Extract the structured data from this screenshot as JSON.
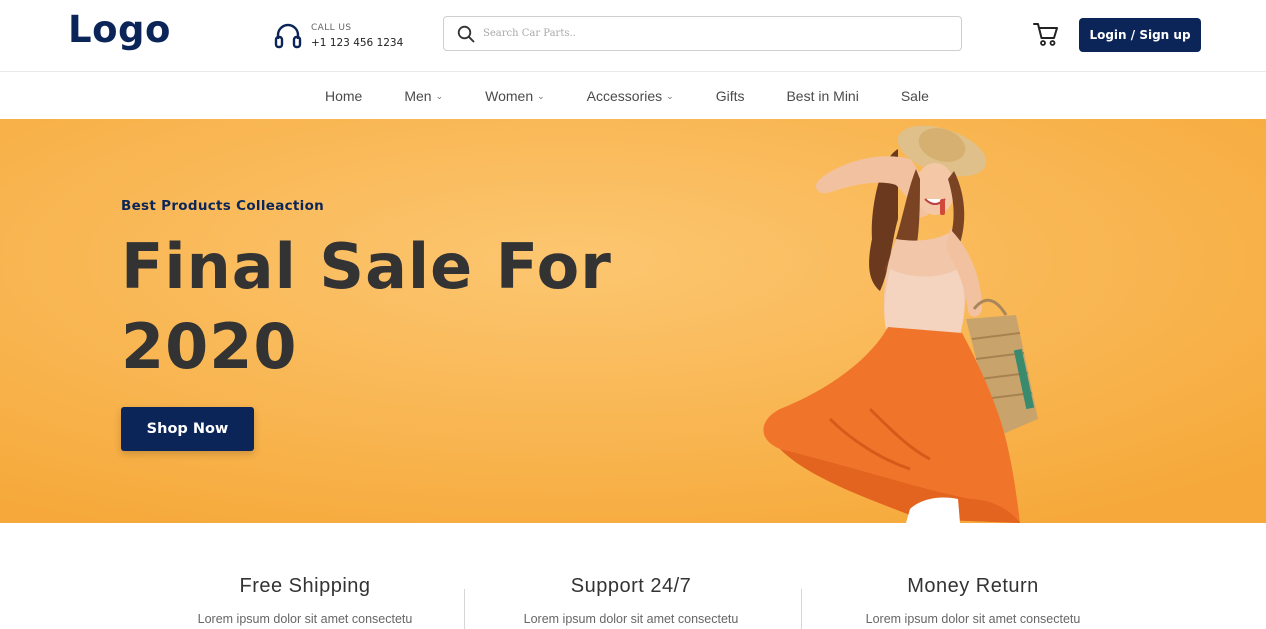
{
  "colors": {
    "brand": "#0b2559",
    "hero_bg": "#f8b349",
    "hero_bg_light": "#fcc670",
    "dress": "#f0752b"
  },
  "header": {
    "logo": "Logo",
    "call_label": "CALL US",
    "phone": "+1 123 456 1234",
    "headset_icon": "headset-icon",
    "search_placeholder": "Search Car Parts..",
    "search_icon": "search-icon",
    "cart_icon": "cart-icon",
    "login_label": "Login / Sign up"
  },
  "nav": {
    "items": [
      {
        "label": "Home",
        "dropdown": false
      },
      {
        "label": "Men",
        "dropdown": true
      },
      {
        "label": "Women",
        "dropdown": true
      },
      {
        "label": "Accessories",
        "dropdown": true
      },
      {
        "label": "Gifts",
        "dropdown": false
      },
      {
        "label": "Best in Mini",
        "dropdown": false
      },
      {
        "label": "Sale",
        "dropdown": false
      }
    ],
    "chevron": "⌄"
  },
  "hero": {
    "eyebrow": "Best Products Colleaction",
    "headline_line1": "Final Sale For",
    "headline_line2": "2020",
    "cta": "Shop Now"
  },
  "features": [
    {
      "title": "Free Shipping",
      "desc": "Lorem ipsum dolor sit amet consectetu"
    },
    {
      "title": "Support 24/7",
      "desc": "Lorem ipsum dolor sit amet consectetu"
    },
    {
      "title": "Money Return",
      "desc": "Lorem ipsum dolor sit amet consectetu"
    }
  ]
}
